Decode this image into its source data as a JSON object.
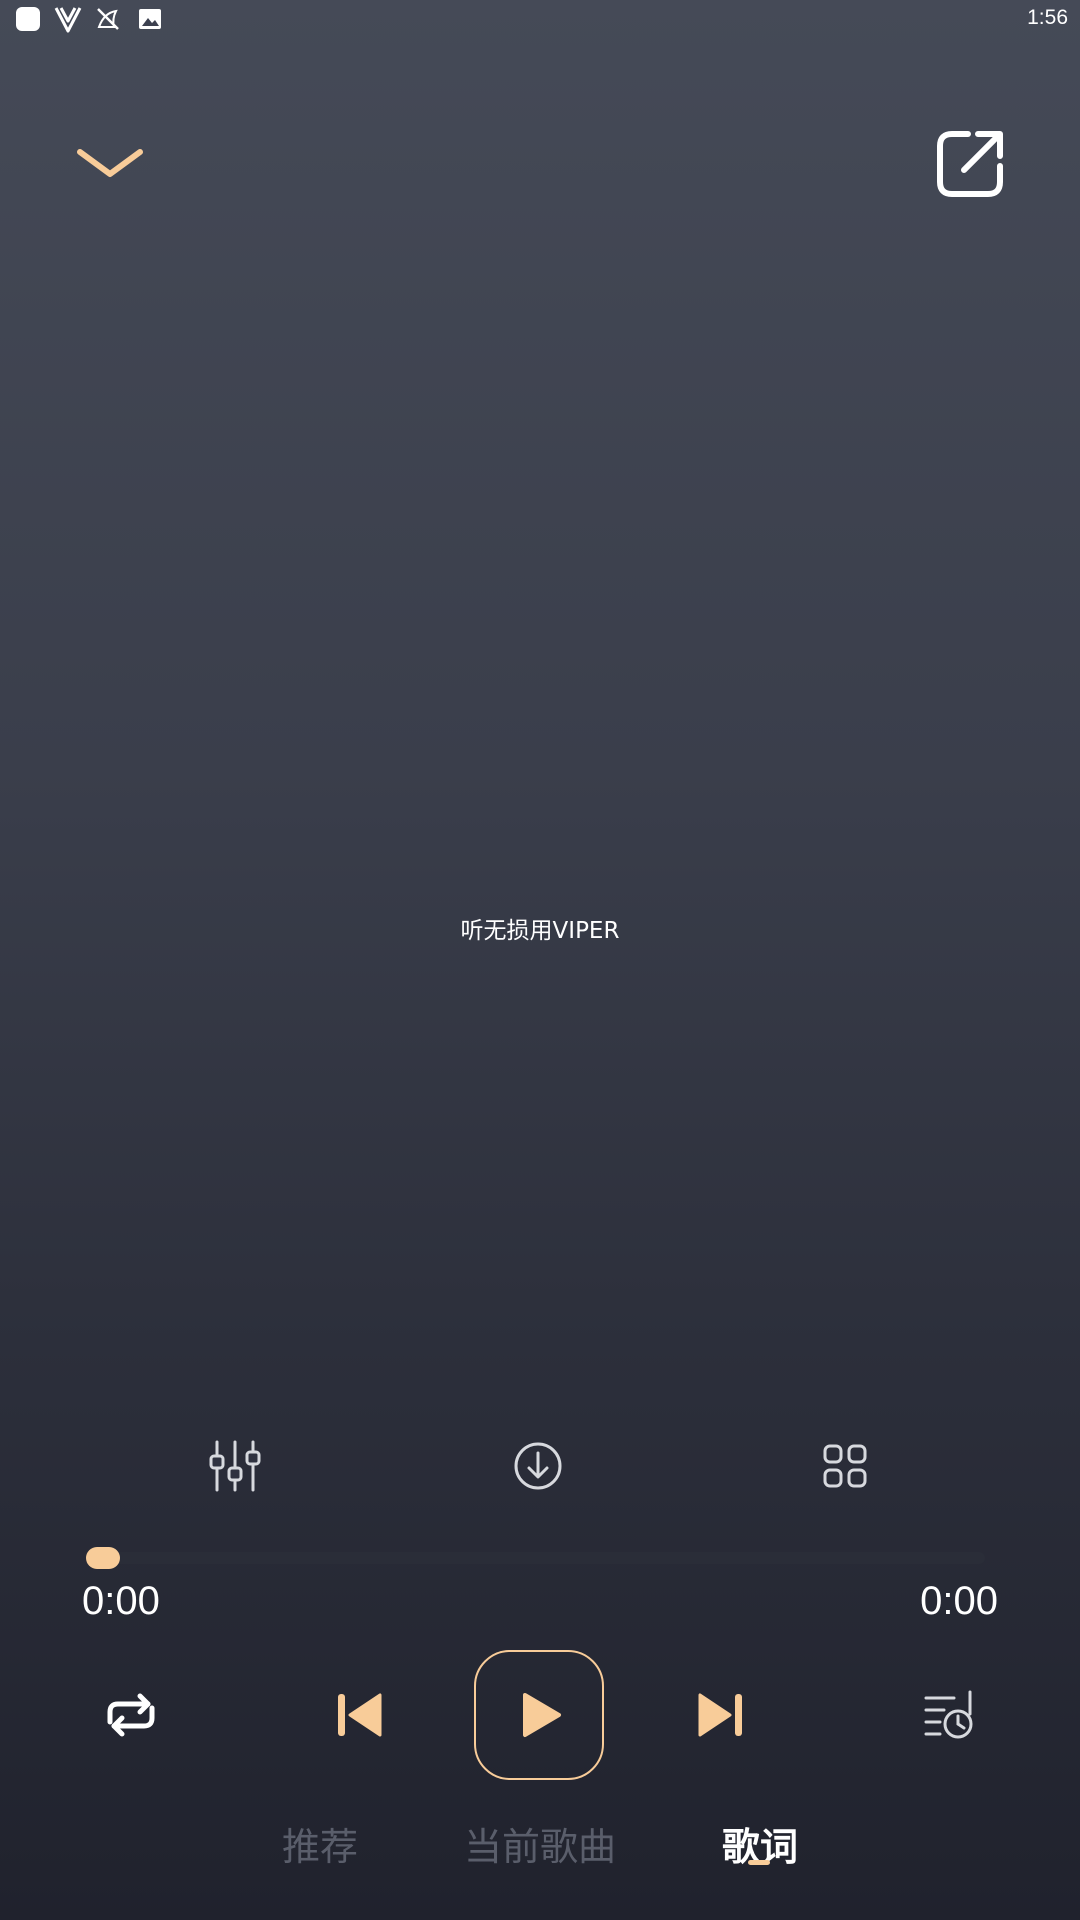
{
  "status_bar": {
    "time": "1:56",
    "icons": [
      "app-square-icon",
      "v-logo-icon",
      "muted-bird-icon",
      "image-icon"
    ]
  },
  "top_bar": {
    "collapse_icon": "chevron-down-icon",
    "share_icon": "share-external-icon"
  },
  "lyrics": {
    "current_line": "听无损用VIPER"
  },
  "actions": {
    "icons": [
      "equalizer-icon",
      "download-icon",
      "more-grid-icon"
    ]
  },
  "progress": {
    "fraction": 0.0,
    "current_time": "0:00",
    "total_time": "0:00"
  },
  "controls": {
    "icons": [
      "repeat-icon",
      "previous-icon",
      "play-icon",
      "next-icon",
      "playlist-timer-icon"
    ]
  },
  "tabs": [
    {
      "label": "推荐",
      "active": false
    },
    {
      "label": "当前歌曲",
      "active": false
    },
    {
      "label": "歌词",
      "active": true
    }
  ],
  "colors": {
    "accent": "#f8cc99",
    "tab_inactive": "#5a5e6b",
    "text": "#ffffff"
  }
}
